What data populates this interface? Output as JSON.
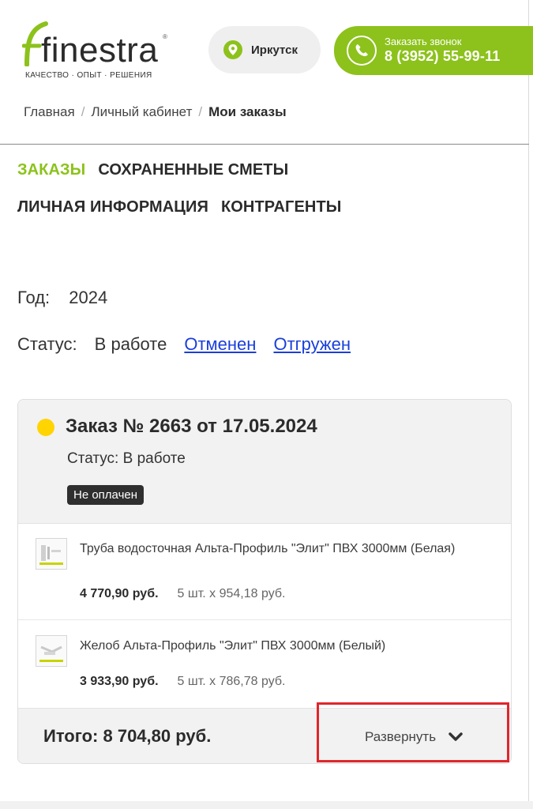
{
  "header": {
    "logo": {
      "wordmark": "finestra",
      "tagline": "КАЧЕСТВО · ОПЫТ · РЕШЕНИЯ"
    },
    "city": {
      "label": "Иркутск",
      "icon": "map-pin-icon"
    },
    "call": {
      "label": "Заказать звонок",
      "phone": "8 (3952) 55-99-11",
      "icon": "phone-icon"
    },
    "colors": {
      "brand_green": "#8cc21b",
      "pin_green": "#8cc21b"
    }
  },
  "breadcrumb": {
    "items": [
      "Главная",
      "Личный кабинет"
    ],
    "current": "Мои заказы",
    "separator": "/"
  },
  "tabs": {
    "orders": "ЗАКАЗЫ",
    "saved_estimates": "СОХРАНЕННЫЕ СМЕТЫ",
    "personal_info": "ЛИЧНАЯ ИНФОРМАЦИЯ",
    "contractors": "КОНТРАГЕНТЫ",
    "active": "orders"
  },
  "filters": {
    "year_label": "Год:",
    "year_value": "2024",
    "status_label": "Статус:",
    "status_current": "В работе",
    "status_links": [
      "Отменен",
      "Отгружен"
    ]
  },
  "order": {
    "title": "Заказ № 2663 от 17.05.2024",
    "status_text": "Статус: В работе",
    "status_color": "#ffd400",
    "payment_badge": "Не оплачен",
    "items": [
      {
        "name": "Труба водосточная Альта-Профиль \"Элит\" ПВХ 3000мм (Белая)",
        "sum": "4 770,90 руб.",
        "qty": "5 шт. x 954,18 руб."
      },
      {
        "name": "Желоб Альта-Профиль \"Элит\" ПВХ 3000мм (Белый)",
        "sum": "3 933,90 руб.",
        "qty": "5 шт. x 786,78 руб."
      }
    ],
    "total": "Итого: 8 704,80 руб.",
    "expand_label": "Развернуть",
    "expand_icon": "chevron-down-icon"
  }
}
